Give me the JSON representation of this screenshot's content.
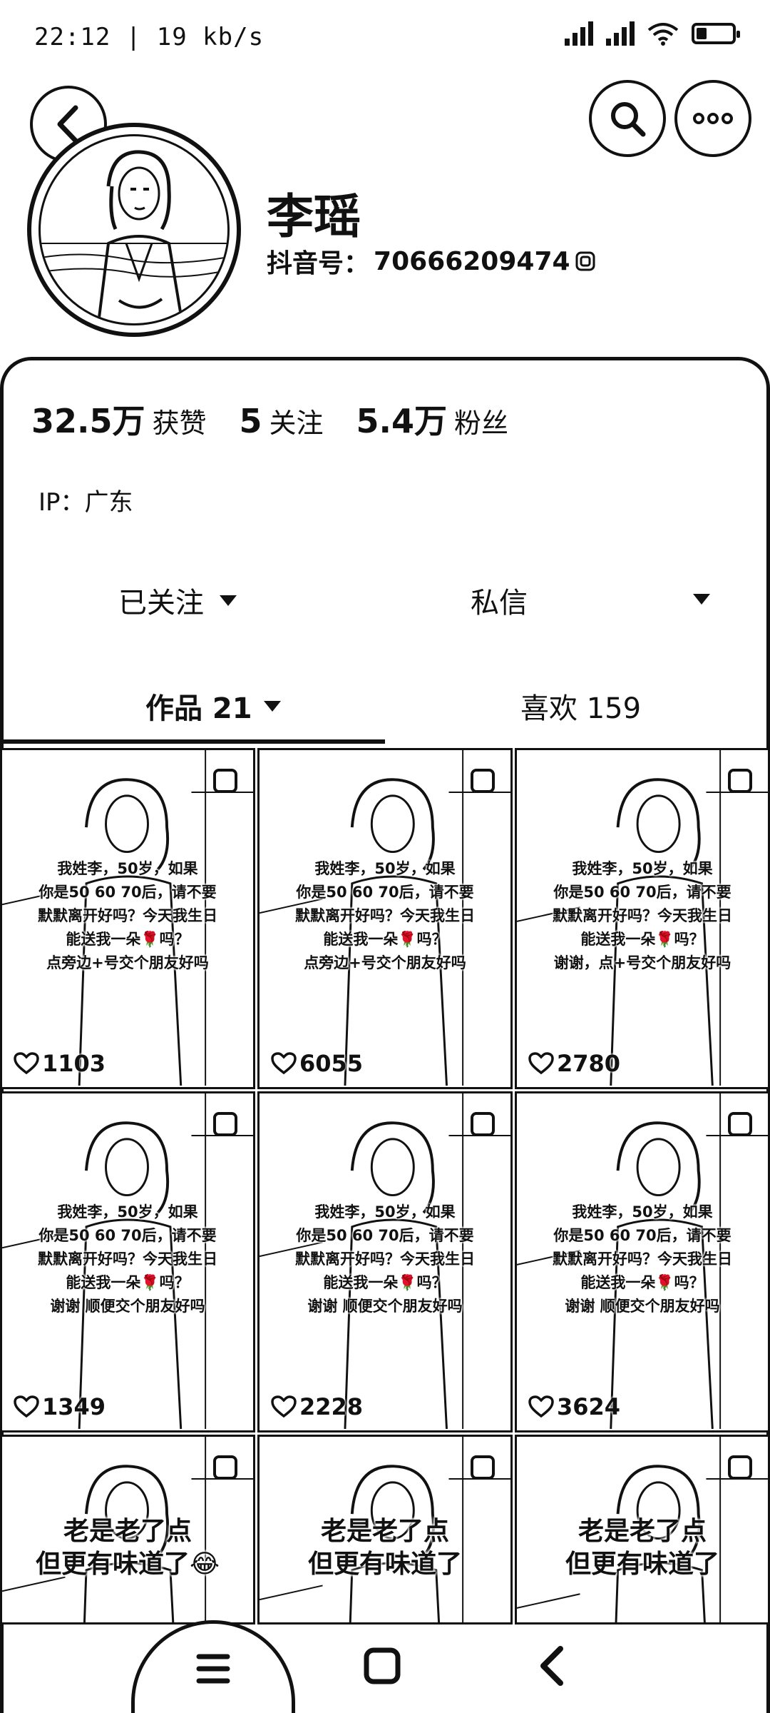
{
  "status_bar": {
    "time_text": "22:12 | 19 kb/s",
    "battery_level": 0.25
  },
  "header": {
    "back_icon": "chevron-left-icon",
    "search_icon": "search-icon",
    "more_icon": "more-dots-icon"
  },
  "profile": {
    "nickname": "李瑶",
    "douyin_id_label": "抖音号：",
    "douyin_id": "70666209474",
    "copy_icon": "copy-icon"
  },
  "stats": [
    {
      "value": "32.5万",
      "label": "获赞"
    },
    {
      "value": "5",
      "label": "关注"
    },
    {
      "value": "5.4万",
      "label": "粉丝"
    }
  ],
  "ip": "IP：广东",
  "actions": {
    "follow_label": "已关注",
    "message_label": "私信"
  },
  "tabs": {
    "works_label": "作品 21",
    "likes_label": "喜欢 159"
  },
  "videos": [
    {
      "likes": "1103",
      "lines": [
        "我姓李，50岁，如果",
        "你是50 60 70后，请不要",
        "默默离开好吗？今天我生日",
        "能送我一朵🌹吗？",
        "点旁边+号交个朋友好吗"
      ]
    },
    {
      "likes": "6055",
      "lines": [
        "我姓李，50岁，如果",
        "你是50 60 70后，请不要",
        "默默离开好吗？今天我生日",
        "能送我一朵🌹吗？",
        "点旁边+号交个朋友好吗"
      ]
    },
    {
      "likes": "2780",
      "lines": [
        "我姓李，50岁，如果",
        "你是50 60 70后，请不要",
        "默默离开好吗？今天我生日",
        "能送我一朵🌹吗？",
        "谢谢，点+号交个朋友好吗"
      ]
    },
    {
      "likes": "1349",
      "lines": [
        "我姓李，50岁，如果",
        "你是50 60 70后，请不要",
        "默默离开好吗？今天我生日",
        "能送我一朵🌹吗？",
        "谢谢  顺便交个朋友好吗"
      ]
    },
    {
      "likes": "2228",
      "lines": [
        "我姓李，50岁，如果",
        "你是50 60 70后，请不要",
        "默默离开好吗？今天我生日",
        "能送我一朵🌹吗？",
        "谢谢  顺便交个朋友好吗"
      ]
    },
    {
      "likes": "3624",
      "lines": [
        "我姓李，50岁，如果",
        "你是50 60 70后，请不要",
        "默默离开好吗？今天我生日",
        "能送我一朵🌹吗？",
        "谢谢  顺便交个朋友好吗"
      ]
    },
    {
      "likes": "",
      "lines": [
        "老是老了点",
        "但更有味道了😂"
      ]
    },
    {
      "likes": "",
      "lines": [
        "老是老了点",
        "但更有味道了"
      ]
    },
    {
      "likes": "",
      "lines": [
        "老是老了点",
        "但更有味道了"
      ]
    }
  ],
  "navbar": {
    "menu_icon": "menu-icon",
    "home_icon": "home-square-icon",
    "back_icon": "back-chevron-icon"
  }
}
